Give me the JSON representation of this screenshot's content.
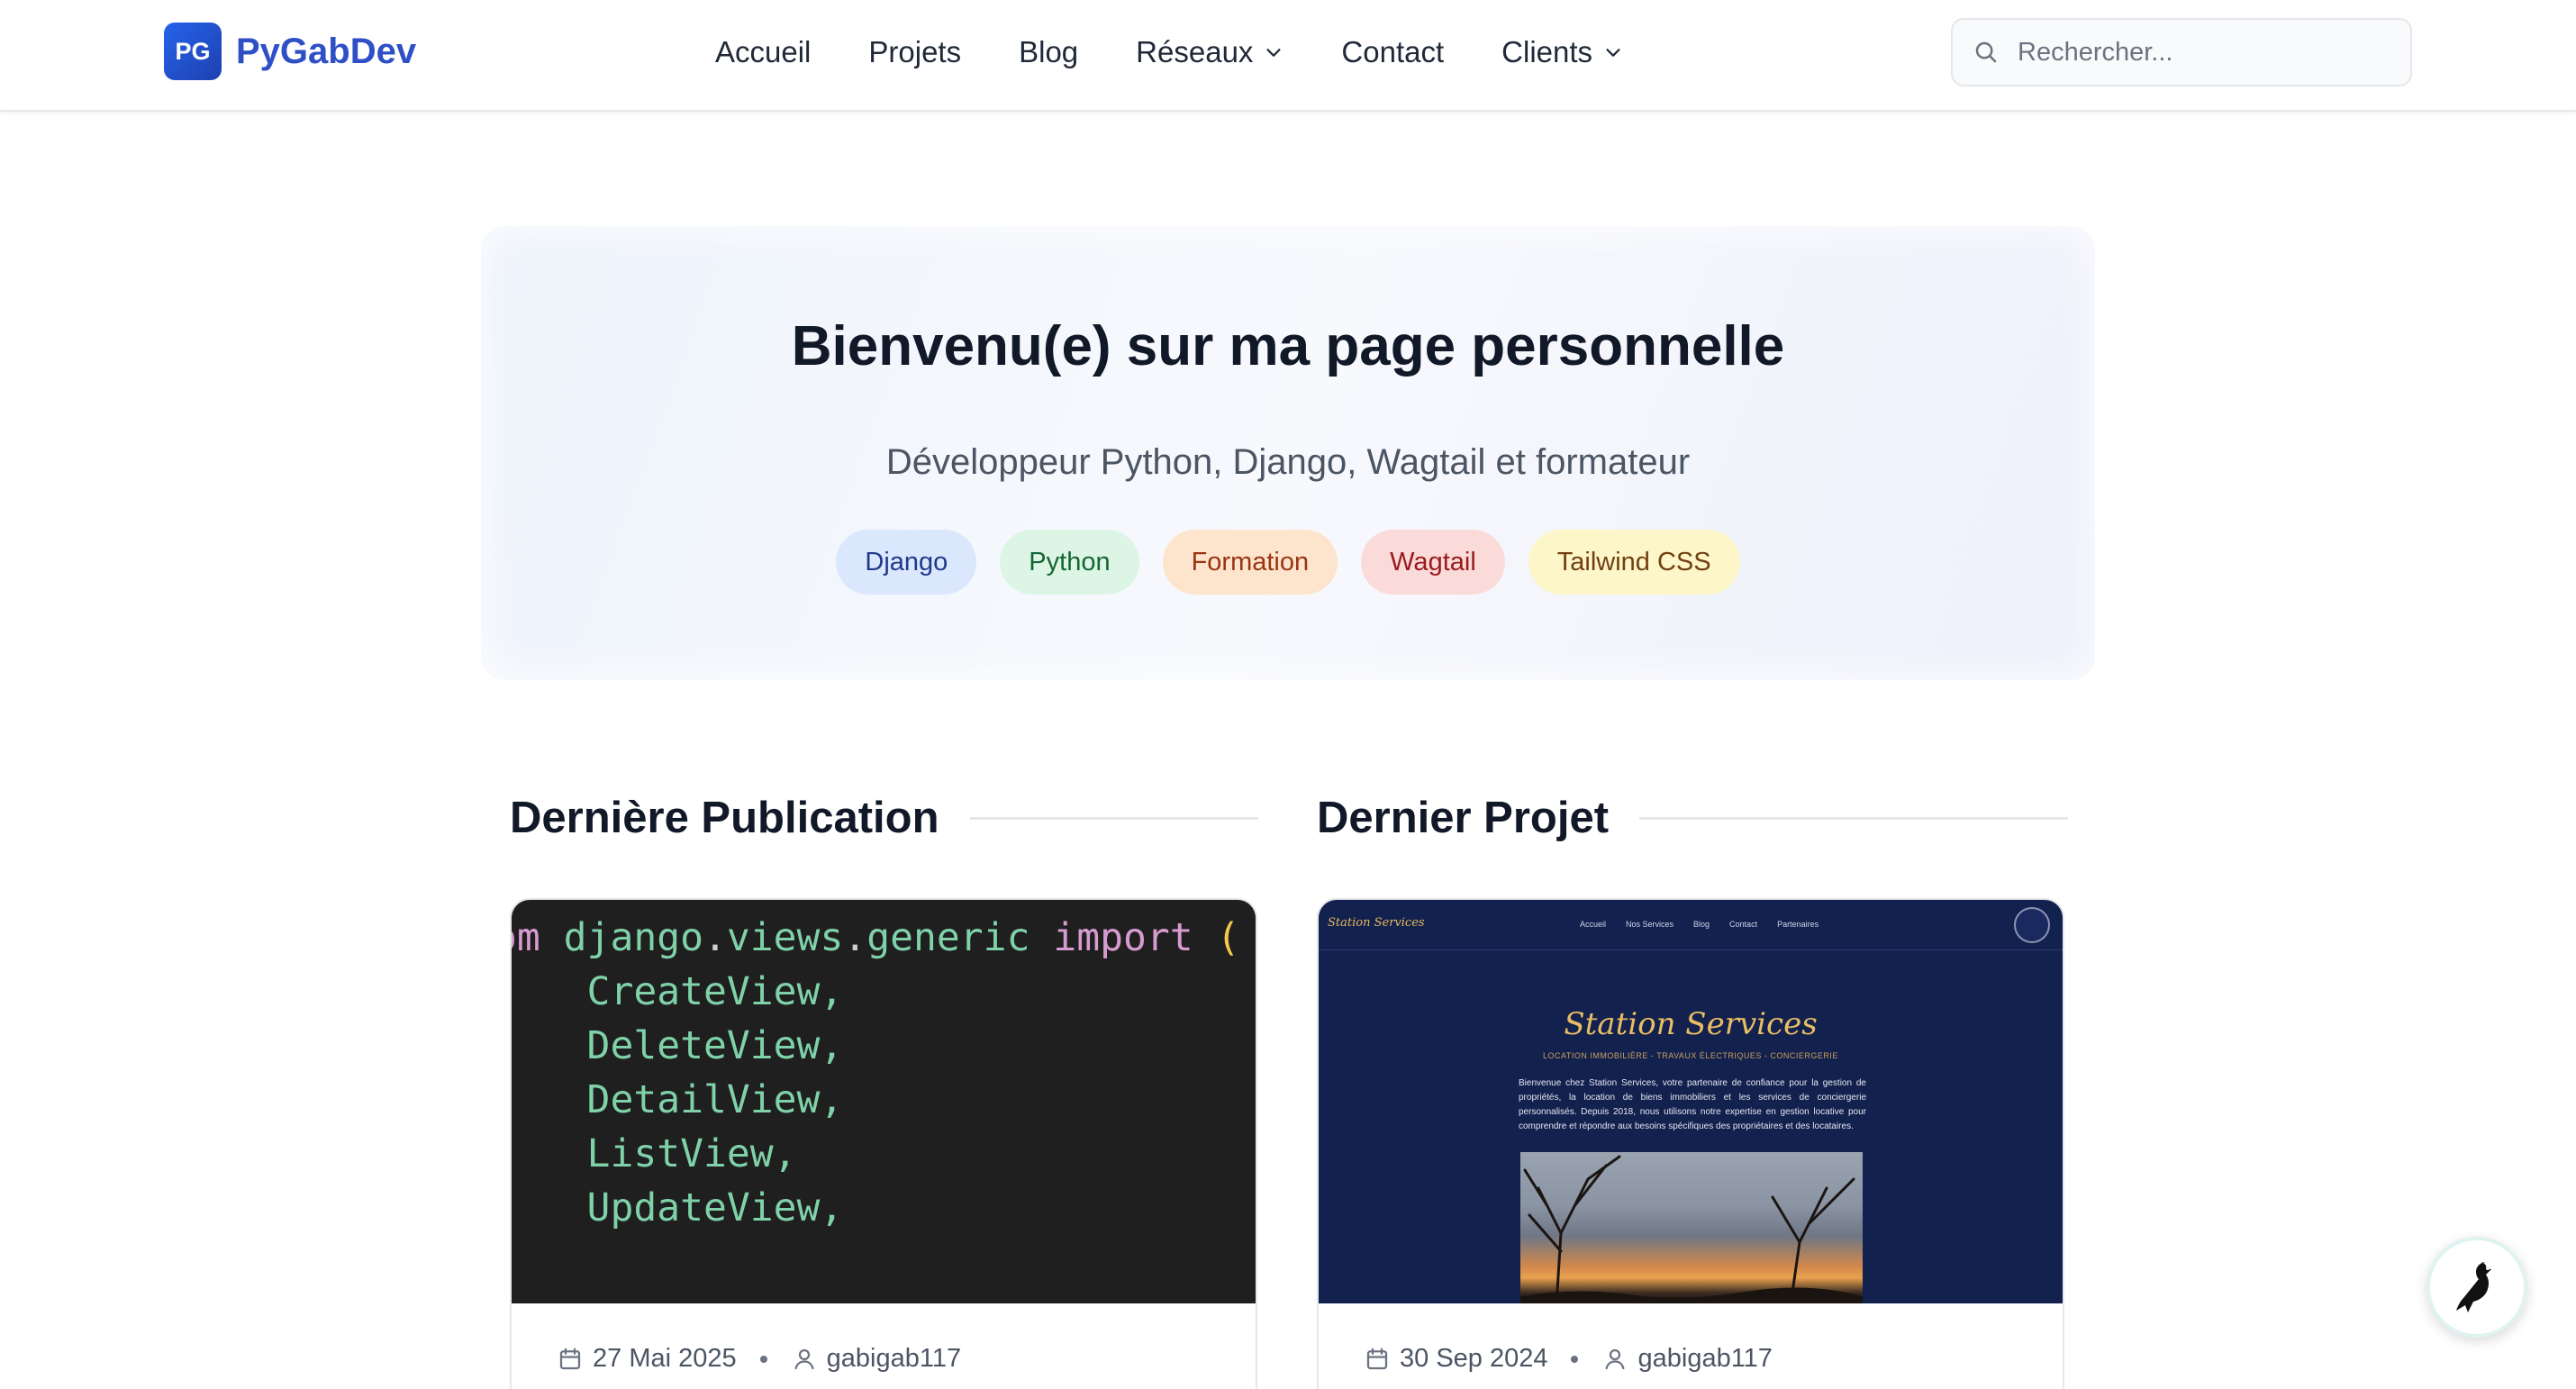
{
  "brand": {
    "badge": "PG",
    "name": "PyGabDev"
  },
  "nav": {
    "items": [
      {
        "label": "Accueil",
        "dropdown": false
      },
      {
        "label": "Projets",
        "dropdown": false
      },
      {
        "label": "Blog",
        "dropdown": false
      },
      {
        "label": "Réseaux",
        "dropdown": true
      },
      {
        "label": "Contact",
        "dropdown": false
      },
      {
        "label": "Clients",
        "dropdown": true
      }
    ],
    "search_placeholder": "Rechercher..."
  },
  "hero": {
    "title": "Bienvenu(e) sur ma page personnelle",
    "subtitle": "Développeur Python, Django, Wagtail et formateur",
    "tags": [
      "Django",
      "Python",
      "Formation",
      "Wagtail",
      "Tailwind CSS"
    ]
  },
  "latest_post": {
    "heading": "Dernière Publication",
    "code_lines": [
      "om django.views.generic import (",
      "    CreateView,",
      "    DeleteView,",
      "    DetailView,",
      "    ListView,",
      "    UpdateView,"
    ],
    "date": "27 Mai 2025",
    "author": "gabigab117"
  },
  "latest_project": {
    "heading": "Dernier Projet",
    "preview": {
      "logo": "Station Services",
      "nav_links": [
        "Accueil",
        "Nos Services",
        "Blog",
        "Contact",
        "Partenaires"
      ],
      "title": "Station Services",
      "subtitle": "LOCATION IMMOBILIÈRE - TRAVAUX ÉLECTRIQUES - CONCIERGERIE",
      "text": "Bienvenue chez Station Services, votre partenaire de confiance pour la gestion de propriétés, la location de biens immobiliers et les services de conciergerie personnalisés. Depuis 2018, nous utilisons notre expertise en gestion locative pour comprendre et répondre aux besoins spécifiques des propriétaires et des locataires."
    },
    "date": "30 Sep 2024",
    "author": "gabigab117"
  },
  "colors": {
    "brand": "#2f4fc7",
    "code_bg": "#1f1f1f",
    "project_bg": "#13214f"
  }
}
